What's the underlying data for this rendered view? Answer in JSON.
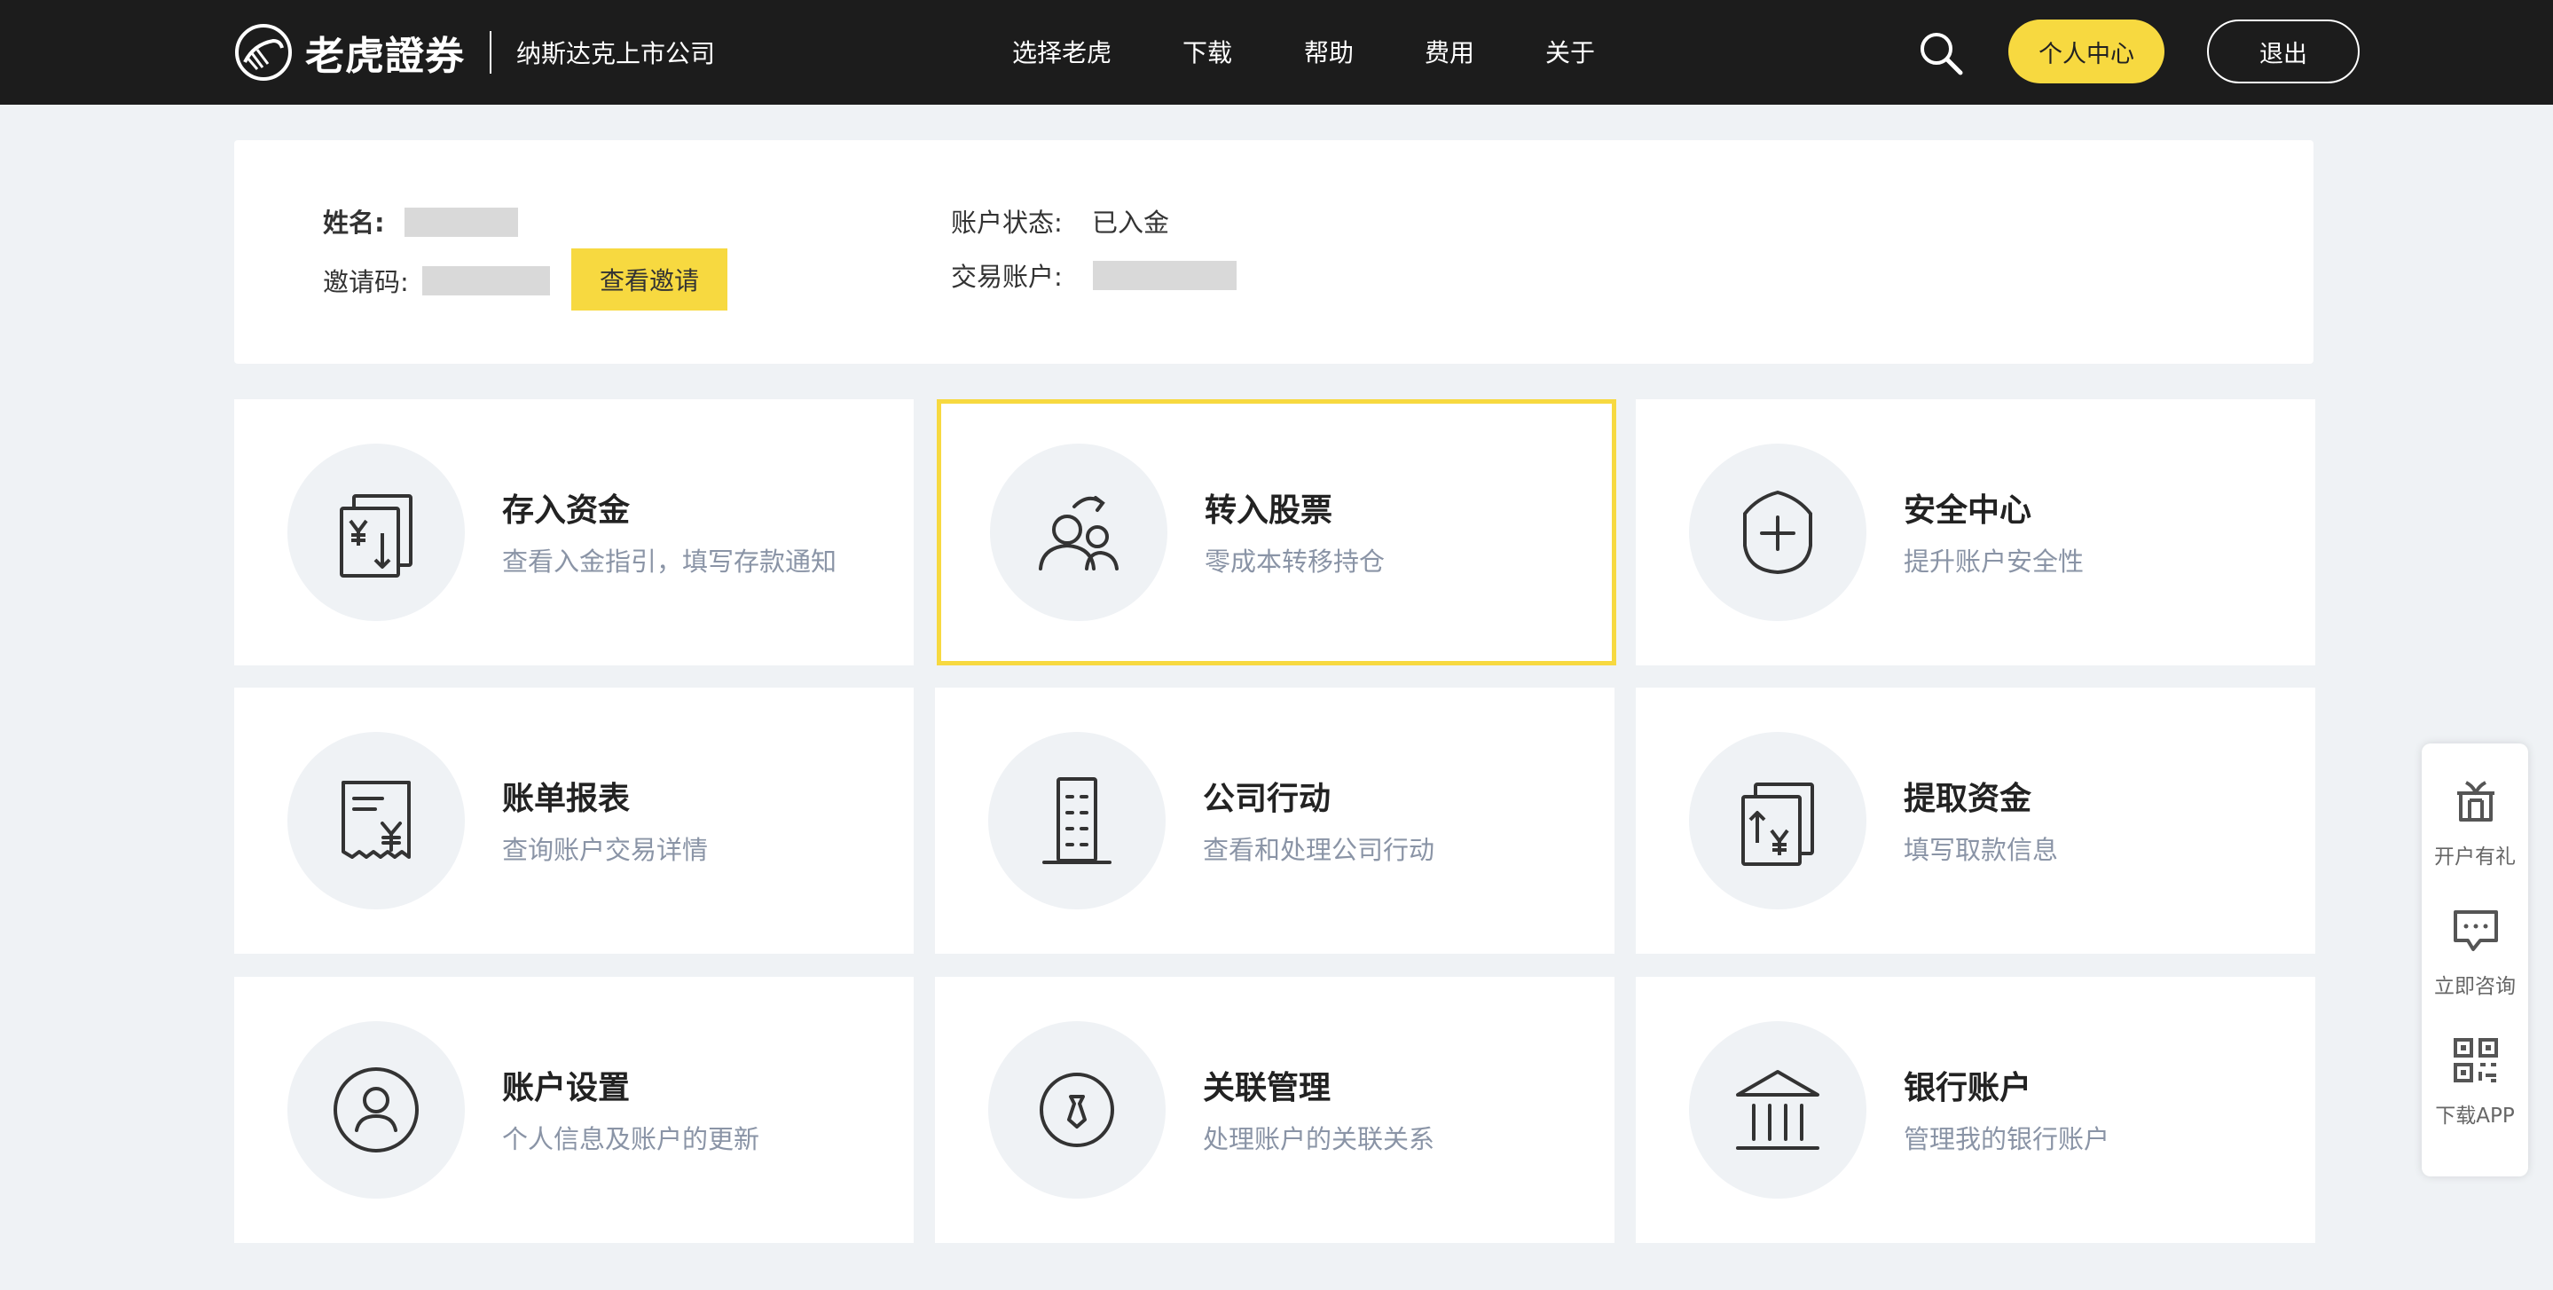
{
  "header": {
    "brand": "老虎證券",
    "tagline": "纳斯达克上市公司",
    "nav": [
      "选择老虎",
      "下载",
      "帮助",
      "费用",
      "关于"
    ],
    "search_icon": "search-icon",
    "personal_center": "个人中心",
    "logout": "退出"
  },
  "account": {
    "name_label": "姓名:",
    "invite_code_label": "邀请码:",
    "view_invite": "查看邀请",
    "status_label": "账户状态:",
    "status_value": "已入金",
    "trading_account_label": "交易账户:"
  },
  "cards": [
    {
      "title": "存入资金",
      "desc": "查看入金指引，填写存款通知",
      "icon": "deposit-yen-icon"
    },
    {
      "title": "转入股票",
      "desc": "零成本转移持仓",
      "icon": "transfer-users-icon"
    },
    {
      "title": "安全中心",
      "desc": "提升账户安全性",
      "icon": "shield-plus-icon"
    },
    {
      "title": "账单报表",
      "desc": "查询账户交易详情",
      "icon": "receipt-icon"
    },
    {
      "title": "公司行动",
      "desc": "查看和处理公司行动",
      "icon": "building-icon"
    },
    {
      "title": "提取资金",
      "desc": "填写取款信息",
      "icon": "withdraw-yen-icon"
    },
    {
      "title": "账户设置",
      "desc": "个人信息及账户的更新",
      "icon": "user-circle-icon"
    },
    {
      "title": "关联管理",
      "desc": "处理账户的关联关系",
      "icon": "tie-circle-icon"
    },
    {
      "title": "银行账户",
      "desc": "管理我的银行账户",
      "icon": "bank-icon"
    }
  ],
  "side_panel": [
    {
      "label": "开户有礼",
      "icon": "gift-icon"
    },
    {
      "label": "立即咨询",
      "icon": "chat-icon"
    },
    {
      "label": "下载APP",
      "icon": "qr-code-icon"
    }
  ],
  "colors": {
    "accent": "#f7d940",
    "nav_bg": "#1c1c1c",
    "page_bg": "#eff2f5",
    "desc_text": "#8a94a6"
  }
}
